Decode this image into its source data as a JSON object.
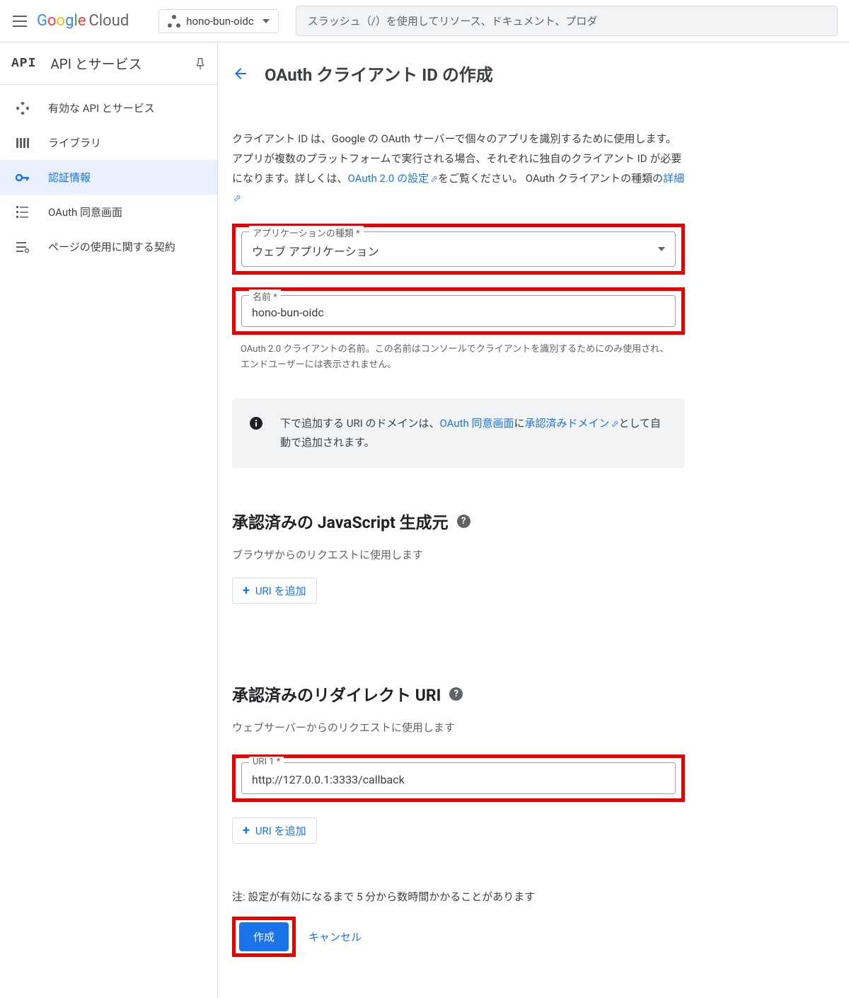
{
  "topbar": {
    "logo_text": "Google",
    "cloud_text": " Cloud",
    "project_name": "hono-bun-oidc",
    "search_placeholder": "スラッシュ（/）を使用してリソース、ドキュメント、プロダ"
  },
  "sidebar": {
    "api_logo": "API",
    "title": "API とサービス",
    "items": [
      {
        "label": "有効な API とサービス"
      },
      {
        "label": "ライブラリ"
      },
      {
        "label": "認証情報"
      },
      {
        "label": "OAuth 同意画面"
      },
      {
        "label": "ページの使用に関する契約"
      }
    ]
  },
  "page": {
    "title": "OAuth クライアント ID の作成",
    "description_part1": "クライアント ID は、Google の OAuth サーバーで個々のアプリを識別するために使用します。アプリが複数のプラットフォームで実行される場合、それぞれに独自のクライアント ID が必要になります。詳しくは、",
    "description_link1": "OAuth 2.0 の設定",
    "description_part2": "をご覧ください。 OAuth クライアントの種類の",
    "description_link2": "詳細",
    "app_type_label": "アプリケーションの種類 *",
    "app_type_value": "ウェブ アプリケーション",
    "name_label": "名前 *",
    "name_value": "hono-bun-oidc",
    "name_helper": "OAuth 2.0 クライアントの名前。この名前はコンソールでクライアントを識別するためにのみ使用され、エンドユーザーには表示されません。",
    "info_part1": "下で追加する URI のドメインは、",
    "info_link1": "OAuth 同意画面",
    "info_part2": "に",
    "info_link2": "承認済みドメイン",
    "info_part3": "として自動で追加されます。",
    "js_origins_title": "承認済みの JavaScript 生成元",
    "js_origins_sub": "ブラウザからのリクエストに使用します",
    "add_uri_label": "URI を追加",
    "redirect_title": "承認済みのリダイレクト URI",
    "redirect_sub": "ウェブサーバーからのリクエストに使用します",
    "uri1_label": "URI 1 *",
    "uri1_value": "http://127.0.0.1:3333/callback",
    "note": "注: 設定が有効になるまで 5 分から数時間かかることがあります",
    "create_label": "作成",
    "cancel_label": "キャンセル"
  }
}
